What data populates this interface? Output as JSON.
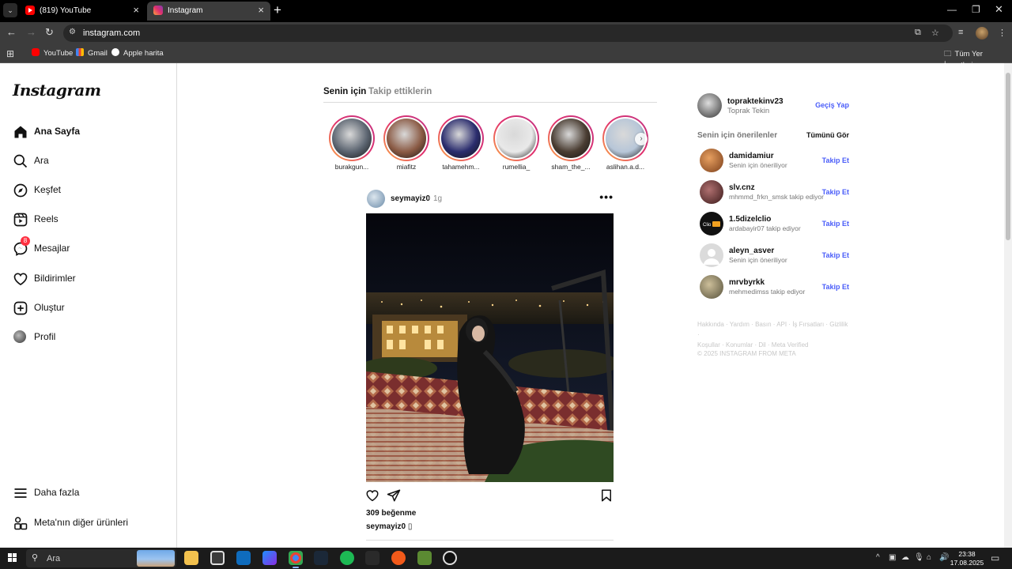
{
  "browser": {
    "tabs": [
      {
        "title": "(819) YouTube",
        "icon": "youtube-icon"
      },
      {
        "title": "Instagram",
        "icon": "instagram-icon"
      }
    ],
    "url": "instagram.com",
    "bookmarks": [
      {
        "label": "YouTube",
        "icon": "youtube-icon"
      },
      {
        "label": "Gmail",
        "icon": "gmail-icon"
      },
      {
        "label": "Apple harita",
        "icon": "apple-icon"
      }
    ],
    "all_bookmarks": "Tüm Yer İşaretleri"
  },
  "sidebar": {
    "logo": "Instagram",
    "items": [
      {
        "label": "Ana Sayfa",
        "icon": "home-icon"
      },
      {
        "label": "Ara",
        "icon": "search-icon"
      },
      {
        "label": "Keşfet",
        "icon": "compass-icon"
      },
      {
        "label": "Reels",
        "icon": "reels-icon"
      },
      {
        "label": "Mesajlar",
        "icon": "messenger-icon",
        "badge": "8"
      },
      {
        "label": "Bildirimler",
        "icon": "heart-icon"
      },
      {
        "label": "Oluştur",
        "icon": "plus-square-icon"
      },
      {
        "label": "Profil",
        "icon": "profile-avatar"
      }
    ],
    "more": "Daha fazla",
    "meta": "Meta'nın diğer ürünleri"
  },
  "feed": {
    "tabs": [
      "Senin için",
      "Takip ettiklerin"
    ],
    "stories": [
      {
        "name": "burakgun...",
        "color": "#5b6470"
      },
      {
        "name": "miafitz",
        "color": "#8a5a44"
      },
      {
        "name": "tahamehm...",
        "color": "#2b2d6e"
      },
      {
        "name": "rumellia_",
        "color": "#e9e9e9"
      },
      {
        "name": "sham_the_...",
        "color": "#4a3d32"
      },
      {
        "name": "aslihan.a.d...",
        "color": "#b7c6d8"
      }
    ],
    "post": {
      "user": "seymayiz0",
      "dot": "•",
      "time": "1g",
      "likes": "309 beğenme",
      "caption_user": "seymayiz0",
      "caption_text": "▯"
    }
  },
  "right": {
    "me": {
      "user": "topraktekinv23",
      "name": "Toprak Tekin"
    },
    "switch": "Geçiş Yap",
    "suggestions_title": "Senin için önerilenler",
    "see_all": "Tümünü Gör",
    "suggestions": [
      {
        "user": "damidamiur",
        "sub": "Senin için öneriliyor",
        "action": "Takip Et",
        "color": "#c9793e"
      },
      {
        "user": "slv.cnz",
        "sub": "mhmmd_frkn_smsk takip ediyor",
        "action": "Takip Et",
        "color": "#7a3b3b"
      },
      {
        "user": "1.5dizelclio",
        "sub": "ardabayir07 takip ediyor",
        "action": "Takip Et",
        "color": "#111111"
      },
      {
        "user": "aleyn_asver",
        "sub": "Senin için öneriliyor",
        "action": "Takip Et",
        "color": "#dcdcdc"
      },
      {
        "user": "mrvbyrkk",
        "sub": "mehmedimss takip ediyor",
        "action": "Takip Et",
        "color": "#9a8a6a"
      }
    ],
    "footer_line1": "Hakkında · Yardım · Basın · API · İş Fırsatları · Gizlilik ·",
    "footer_line2": "Koşullar · Konumlar · Dil · Meta Verified",
    "copyright": "© 2025 INSTAGRAM FROM META"
  },
  "taskbar": {
    "search_placeholder": "Ara",
    "time": "23:38",
    "date": "17.08.2025"
  },
  "colors": {
    "accent_blue": "#4a5df9",
    "story_gradient": [
      "#fcaf45",
      "#e1306c",
      "#c13584"
    ],
    "badge_red": "#ff3040"
  }
}
